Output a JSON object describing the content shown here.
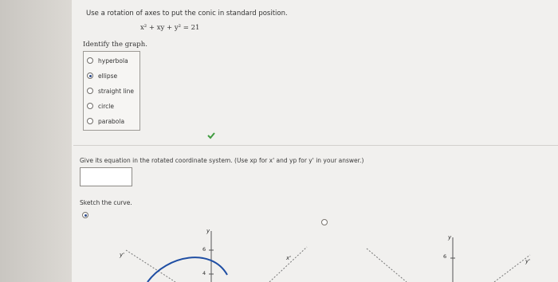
{
  "question": {
    "prompt": "Use a rotation of axes to put the conic in standard position.",
    "equation": "x² + xy + y² = 21",
    "identify_label": "Identify the graph.",
    "options": [
      {
        "label": "hyperbola",
        "selected": false
      },
      {
        "label": "ellipse",
        "selected": true
      },
      {
        "label": "straight line",
        "selected": false
      },
      {
        "label": "circle",
        "selected": false
      },
      {
        "label": "parabola",
        "selected": false
      }
    ],
    "feedback_icon": "checkmark-icon"
  },
  "rotated_equation": {
    "prompt": "Give its equation in the rotated coordinate system. (Use xp for x' and yp for y' in your answer.)",
    "answer_value": ""
  },
  "sketch": {
    "label": "Sketch the curve.",
    "graphs": [
      {
        "selected": true,
        "axis_y": "y",
        "axis_y2": "y'",
        "tick_top": "6",
        "tick_bottom": "4"
      },
      {
        "selected": false,
        "axis_x2": "x'"
      },
      {
        "selected": false,
        "axis_y": "y",
        "axis_y2": "y'",
        "tick_top": "6"
      }
    ]
  },
  "colors": {
    "selected_radio": "#2d4b8a",
    "check_green": "#3f9b3f",
    "curve_blue": "#1f4ea3"
  }
}
